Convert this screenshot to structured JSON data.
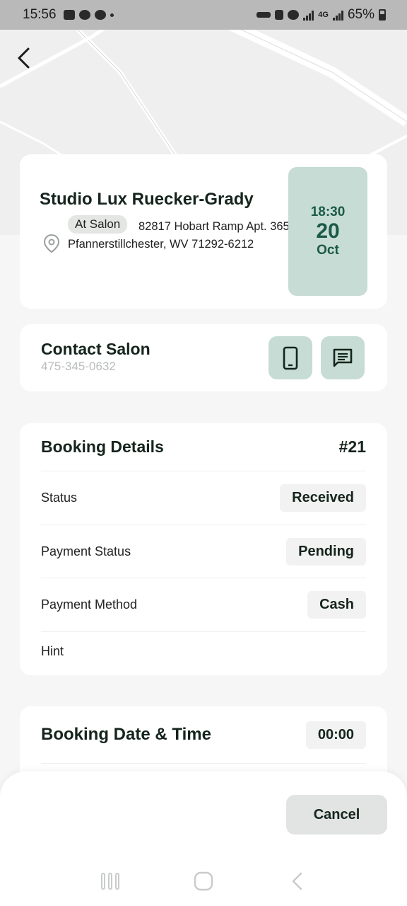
{
  "status_bar": {
    "time": "15:56",
    "battery_percent": "65%",
    "network_label": "4G"
  },
  "salon": {
    "name": "Studio Lux Ruecker-Grady",
    "location_badge": "At Salon",
    "address": "82817 Hobart Ramp Apt. 365 Pfannerstillchester, WV 71292-6212"
  },
  "appointment": {
    "time": "18:30",
    "day": "20",
    "month": "Oct"
  },
  "contact": {
    "title": "Contact Salon",
    "phone": "475-345-0632"
  },
  "booking_details": {
    "title": "Booking Details",
    "id": "#21",
    "rows": [
      {
        "label": "Status",
        "value": "Received"
      },
      {
        "label": "Payment Status",
        "value": "Pending"
      },
      {
        "label": "Payment Method",
        "value": "Cash"
      },
      {
        "label": "Hint",
        "value": ""
      }
    ]
  },
  "booking_datetime": {
    "title": "Booking Date & Time",
    "time": "00:00"
  },
  "actions": {
    "cancel_label": "Cancel"
  },
  "colors": {
    "accent_bg": "#c6dcd4",
    "accent_text": "#1c5a48",
    "dark_text": "#15241c"
  },
  "icons": {
    "back": "arrow-left-icon",
    "location": "map-pin-icon",
    "phone": "smartphone-icon",
    "message": "message-icon"
  }
}
